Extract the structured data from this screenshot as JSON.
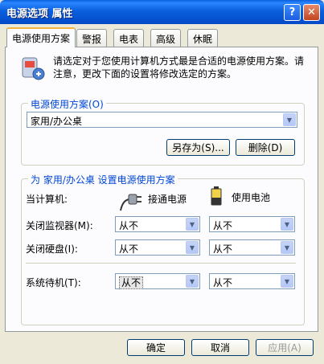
{
  "window": {
    "title": "电源选项 属性",
    "help_label": "?",
    "close_label": "✕"
  },
  "tabs": [
    "电源使用方案",
    "警报",
    "电表",
    "高级",
    "休眠"
  ],
  "intro": {
    "text": "请选定对于您使用计算机方式最是合适的电源使用方案。请注意，更改下面的设置将修改选定的方案。"
  },
  "scheme": {
    "group_title": "电源使用方案(O)",
    "selected": "家用/办公桌",
    "save_as_label": "另存为(S)...",
    "delete_label": "删除(D)"
  },
  "settings": {
    "group_title": "为 家用/办公桌 设置电源使用方案",
    "when_label": "当计算机:",
    "plugged_in_label": "接通电源",
    "battery_label": "使用电池",
    "rows": [
      {
        "label": "关闭监视器(M):",
        "ac": "从不",
        "dc": "从不"
      },
      {
        "label": "关闭硬盘(I):",
        "ac": "从不",
        "dc": "从不"
      },
      {
        "label": "系统待机(T):",
        "ac": "从不",
        "dc": "从不"
      }
    ]
  },
  "footer": {
    "ok_label": "确定",
    "cancel_label": "取消",
    "apply_label": "应用(A)"
  }
}
